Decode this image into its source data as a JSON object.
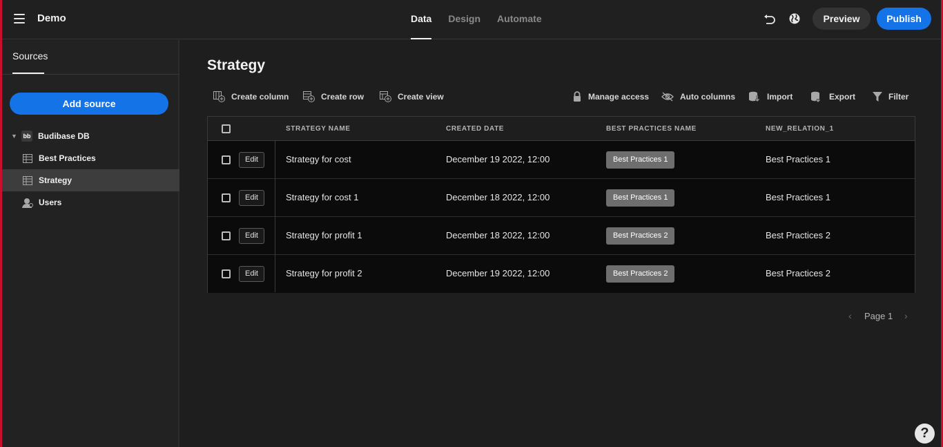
{
  "header": {
    "app_title": "Demo",
    "tabs": [
      {
        "label": "Data",
        "active": true
      },
      {
        "label": "Design",
        "active": false
      },
      {
        "label": "Automate",
        "active": false
      }
    ],
    "preview_label": "Preview",
    "publish_label": "Publish",
    "accent_color": "#1473e6"
  },
  "sidebar": {
    "tab_label": "Sources",
    "add_source_label": "Add source",
    "db": {
      "logo": "bb",
      "label": "Budibase DB"
    },
    "items": [
      {
        "label": "Best Practices",
        "icon": "table-icon",
        "selected": false
      },
      {
        "label": "Strategy",
        "icon": "table-icon",
        "selected": true
      },
      {
        "label": "Users",
        "icon": "user-icon",
        "selected": false
      }
    ]
  },
  "main": {
    "title": "Strategy",
    "toolbar": {
      "create_column": "Create column",
      "create_row": "Create row",
      "create_view": "Create view",
      "manage_access": "Manage access",
      "auto_columns": "Auto columns",
      "import": "Import",
      "export": "Export",
      "filter": "Filter"
    },
    "table": {
      "columns": [
        "STRATEGY NAME",
        "CREATED DATE",
        "BEST PRACTICES NAME",
        "NEW_RELATION_1"
      ],
      "edit_label": "Edit",
      "rows": [
        {
          "name": "Strategy for cost",
          "created": "December 19 2022, 12:00",
          "bp_tag": "Best Practices 1",
          "relation": "Best Practices 1"
        },
        {
          "name": "Strategy for cost 1",
          "created": "December 18 2022, 12:00",
          "bp_tag": "Best Practices 1",
          "relation": "Best Practices 1"
        },
        {
          "name": "Strategy for profit 1",
          "created": "December 18 2022, 12:00",
          "bp_tag": "Best Practices 2",
          "relation": "Best Practices 2"
        },
        {
          "name": "Strategy for profit 2",
          "created": "December 19 2022, 12:00",
          "bp_tag": "Best Practices 2",
          "relation": "Best Practices 2"
        }
      ]
    },
    "pagination": {
      "label": "Page 1"
    }
  },
  "help": {
    "label": "?"
  }
}
